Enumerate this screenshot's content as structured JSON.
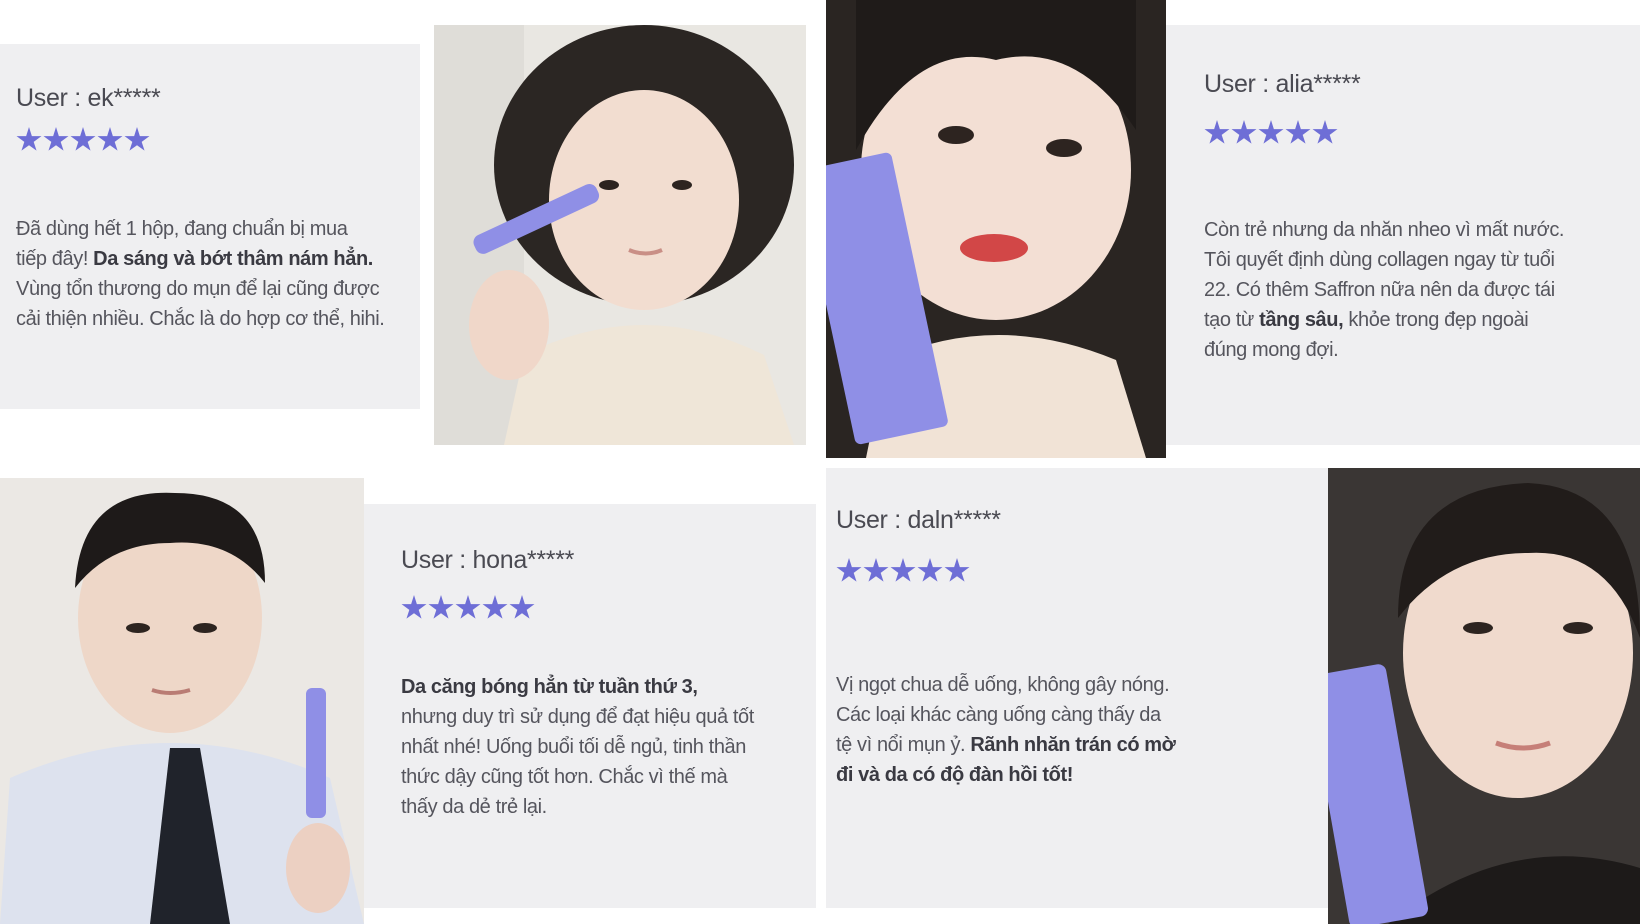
{
  "reviews": [
    {
      "user": "User : ek*****",
      "rating": 5,
      "lines": [
        {
          "pre": "Đã dùng hết 1 hộp, đang chuẩn bị mua",
          "bold": "",
          "post": ""
        },
        {
          "pre": "tiếp đây! ",
          "bold": "Da sáng và bớt thâm nám hẳn.",
          "post": ""
        },
        {
          "pre": "Vùng tổn thương do mụn để lại cũng được",
          "bold": "",
          "post": ""
        },
        {
          "pre": "cải thiện nhiều. Chắc là do hợp cơ thể, hihi.",
          "bold": "",
          "post": ""
        }
      ]
    },
    {
      "user": "User : alia*****",
      "rating": 5,
      "lines": [
        {
          "pre": "Còn trẻ nhưng da nhăn nheo vì mất nước.",
          "bold": "",
          "post": ""
        },
        {
          "pre": "Tôi quyết định dùng collagen ngay từ tuổi",
          "bold": "",
          "post": ""
        },
        {
          "pre": "22. Có thêm Saffron nữa nên da được tái",
          "bold": "",
          "post": ""
        },
        {
          "pre": "tạo từ ",
          "bold": "tầng sâu,",
          "post": " khỏe trong đẹp ngoài"
        },
        {
          "pre": "đúng mong đợi.",
          "bold": "",
          "post": ""
        }
      ]
    },
    {
      "user": "User : hona*****",
      "rating": 5,
      "lines": [
        {
          "pre": "",
          "bold": "Da căng bóng hẳn từ tuần thứ 3,",
          "post": ""
        },
        {
          "pre": "nhưng duy trì sử dụng để đạt hiệu quả tốt",
          "bold": "",
          "post": ""
        },
        {
          "pre": "nhất nhé! Uống buổi tối dễ ngủ, tinh thần",
          "bold": "",
          "post": ""
        },
        {
          "pre": "thức dậy cũng tốt hơn. Chắc vì thế mà",
          "bold": "",
          "post": ""
        },
        {
          "pre": "thấy da dẻ trẻ lại.",
          "bold": "",
          "post": ""
        }
      ]
    },
    {
      "user": "User : daln*****",
      "rating": 5,
      "lines": [
        {
          "pre": "Vị ngọt chua dễ uống, không gây nóng.",
          "bold": "",
          "post": ""
        },
        {
          "pre": "Các loại khác càng uống càng thấy da",
          "bold": "",
          "post": ""
        },
        {
          "pre": "tệ vì nổi mụn ỷ. ",
          "bold": "Rãnh nhăn trán có mờ",
          "post": ""
        },
        {
          "pre": "",
          "bold": "đi và da có độ đàn hồi tốt!",
          "post": ""
        }
      ]
    }
  ],
  "colors": {
    "star": "#6e6ed6",
    "card_bg": "#efeff1",
    "product_tube": "#8f8fe6"
  },
  "icons": [
    "star-icon"
  ]
}
